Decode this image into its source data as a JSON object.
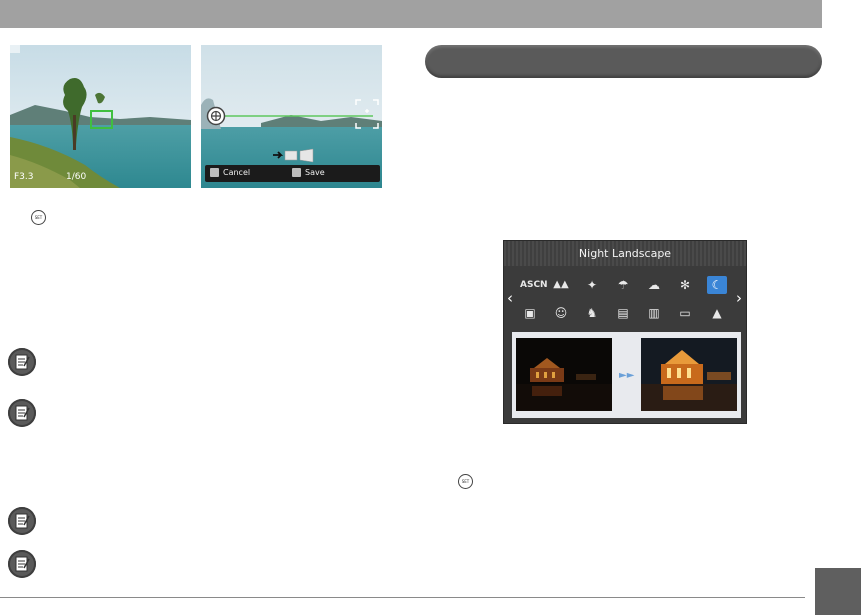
{
  "hud": {
    "exposure": "F3.3",
    "shutter": "1/60"
  },
  "panorama_overlay": {
    "cancel_label": "Cancel",
    "save_label": "Save"
  },
  "set_button_label": "SET",
  "scene_menu": {
    "title": "Night Landscape",
    "row1": [
      "ASCN",
      "▲▲",
      "✦",
      "☂",
      "☁",
      "✻",
      "☾"
    ],
    "row2": [
      "▣",
      "☺",
      "♞",
      "▤",
      "▥",
      "▭",
      "▲"
    ],
    "selected_index": 6
  },
  "colors": {
    "accent": "#3a85d6",
    "header_bar": "#a1a1a1",
    "pill": "#5a5a5a",
    "corner_tab": "#5f5f5f"
  }
}
